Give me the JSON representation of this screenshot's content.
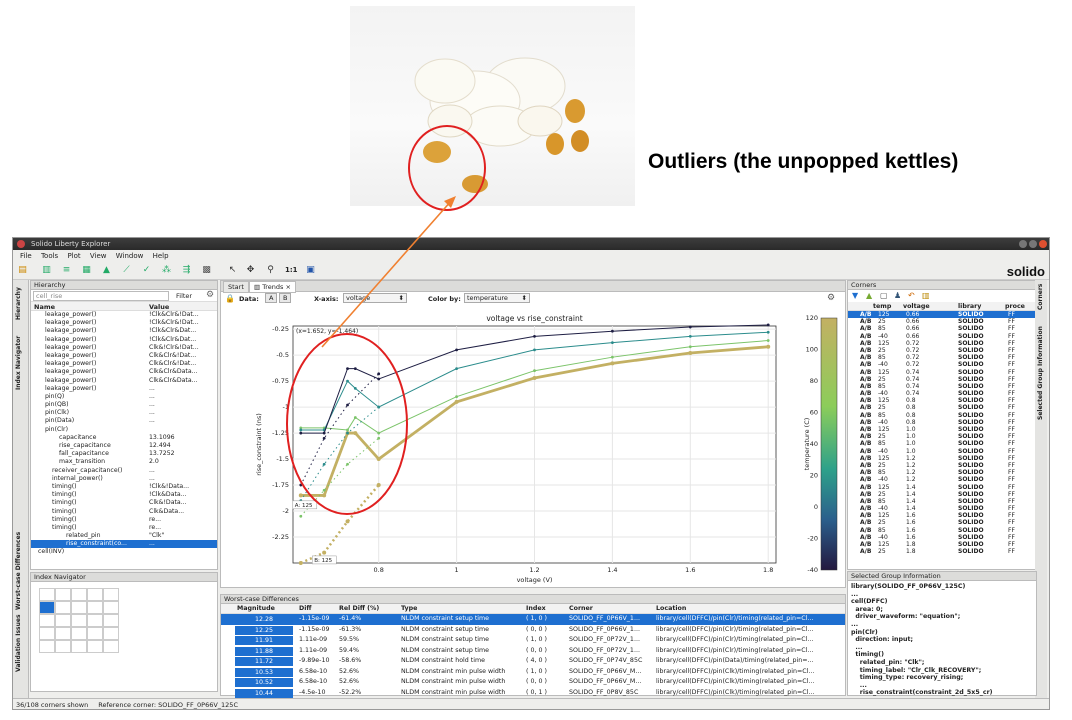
{
  "callout": "Outliers (the unpopped kettles)",
  "app": {
    "title": "Solido Liberty Explorer",
    "logo": "solido"
  },
  "menu": [
    "File",
    "Tools",
    "Plot",
    "View",
    "Window",
    "Help"
  ],
  "toolbar_zoom": "1:1",
  "side_tabs": {
    "left": [
      "Hierarchy",
      "Index Navigator",
      "Worst-case Differences",
      "Validation Issues",
      "Bookmarks"
    ],
    "right": [
      "Corners",
      "Selected Group Information"
    ]
  },
  "hierarchy": {
    "title": "Hierarchy",
    "search": "cell_rise",
    "filter": "Filter",
    "col_name": "Name",
    "col_value": "Value",
    "rows": [
      {
        "n": "leakage_power()",
        "v": "!Clk&Clr&!Dat...",
        "d": 2
      },
      {
        "n": "leakage_power()",
        "v": "!Clk&Clr&!Dat...",
        "d": 2
      },
      {
        "n": "leakage_power()",
        "v": "!Clk&Clr&Dat...",
        "d": 2
      },
      {
        "n": "leakage_power()",
        "v": "!Clk&Clr&Dat...",
        "d": 2
      },
      {
        "n": "leakage_power()",
        "v": "Clk&!Clr&!Dat...",
        "d": 2
      },
      {
        "n": "leakage_power()",
        "v": "Clk&Clr&!Dat...",
        "d": 2
      },
      {
        "n": "leakage_power()",
        "v": "Clk&Clr&!Dat...",
        "d": 2
      },
      {
        "n": "leakage_power()",
        "v": "Clk&Clr&Data...",
        "d": 2
      },
      {
        "n": "leakage_power()",
        "v": "Clk&Clr&Data...",
        "d": 2
      },
      {
        "n": "leakage_power()",
        "v": "...",
        "d": 2
      },
      {
        "n": "pin(Q)",
        "v": "...",
        "d": 2
      },
      {
        "n": "pin(QB)",
        "v": "...",
        "d": 2
      },
      {
        "n": "pin(Clk)",
        "v": "...",
        "d": 2
      },
      {
        "n": "pin(Data)",
        "v": "...",
        "d": 2
      },
      {
        "n": "pin(Clr)",
        "v": "",
        "d": 2
      },
      {
        "n": "capacitance",
        "v": "13.1096",
        "d": 4
      },
      {
        "n": "rise_capacitance",
        "v": "12.494",
        "d": 4
      },
      {
        "n": "fall_capacitance",
        "v": "13.7252",
        "d": 4
      },
      {
        "n": "max_transition",
        "v": "2.0",
        "d": 4
      },
      {
        "n": "receiver_capacitance()",
        "v": "...",
        "d": 3
      },
      {
        "n": "internal_power()",
        "v": "...",
        "d": 3
      },
      {
        "n": "timing()",
        "v": "!Clk&!Data...",
        "d": 3
      },
      {
        "n": "timing()",
        "v": "!Clk&Data...",
        "d": 3
      },
      {
        "n": "timing()",
        "v": "Clk&!Data...",
        "d": 3
      },
      {
        "n": "timing()",
        "v": "Clk&Data...",
        "d": 3
      },
      {
        "n": "timing()",
        "v": "re...",
        "d": 3
      },
      {
        "n": "timing()",
        "v": "re...",
        "d": 3
      },
      {
        "n": "related_pin",
        "v": "\"Clk\"",
        "d": 5
      },
      {
        "n": "rise_constraint(co...",
        "v": "...",
        "d": 5,
        "sel": true
      },
      {
        "n": "cell(INV)",
        "v": "",
        "d": 1
      }
    ]
  },
  "index_nav": {
    "title": "Index Navigator"
  },
  "tabs": [
    "Start",
    "Trends"
  ],
  "trends_bar": {
    "data_label": "Data:",
    "data_a": "A",
    "data_b": "B",
    "xaxis_label": "X-axis:",
    "xaxis_value": "voltage",
    "color_label": "Color by:",
    "color_value": "temperature"
  },
  "chart_data": {
    "type": "line",
    "title": "voltage vs rise_constraint",
    "xlabel": "voltage (V)",
    "ylabel": "rise_constraint (ns)",
    "colorbar_label": "temperature (C)",
    "coord_readout": "(x=1.652, y=-1.464)",
    "xlim": [
      0.58,
      1.82
    ],
    "ylim": [
      -2.5,
      -0.22
    ],
    "xticks": [
      0.8,
      1.0,
      1.2,
      1.4,
      1.6,
      1.8
    ],
    "yticks": [
      -0.25,
      -0.5,
      -0.75,
      -1.0,
      -1.25,
      -1.5,
      -1.75,
      -2.0,
      -2.25
    ],
    "cbar_ticks": [
      120,
      100,
      80,
      60,
      40,
      20,
      0,
      -20,
      -40
    ],
    "point_labels": [
      {
        "text": "A: 125",
        "x": 0.6,
        "y": -1.95
      },
      {
        "text": "B: 125",
        "x": 0.65,
        "y": -2.48
      }
    ],
    "series": [
      {
        "temp": 125,
        "x": [
          0.6,
          0.66,
          0.72,
          0.74,
          0.8,
          1.0,
          1.2,
          1.4,
          1.6,
          1.8
        ],
        "y": [
          -1.85,
          -1.85,
          -1.25,
          -1.25,
          -1.5,
          -0.95,
          -0.72,
          -0.58,
          -0.48,
          -0.42
        ],
        "width": 2.8
      },
      {
        "temp": 85,
        "x": [
          0.6,
          0.66,
          0.72,
          0.74,
          0.8,
          1.0,
          1.2,
          1.4,
          1.6,
          1.8
        ],
        "y": [
          -1.2,
          -1.2,
          -1.22,
          -1.1,
          -1.25,
          -0.9,
          -0.65,
          -0.52,
          -0.42,
          -0.36
        ],
        "width": 1
      },
      {
        "temp": 25,
        "x": [
          0.6,
          0.66,
          0.72,
          0.74,
          0.8,
          1.0,
          1.2,
          1.4,
          1.6,
          1.8
        ],
        "y": [
          -1.22,
          -1.22,
          -0.75,
          -0.82,
          -1.0,
          -0.63,
          -0.45,
          -0.38,
          -0.32,
          -0.28
        ],
        "width": 1
      },
      {
        "temp": -40,
        "x": [
          0.6,
          0.66,
          0.72,
          0.74,
          0.8,
          1.0,
          1.2,
          1.4,
          1.6,
          1.8
        ],
        "y": [
          -1.25,
          -1.25,
          -0.63,
          -0.63,
          -0.73,
          -0.45,
          -0.32,
          -0.27,
          -0.23,
          -0.21
        ],
        "width": 1
      },
      {
        "temp": 125,
        "dotted": true,
        "x": [
          0.6,
          0.66,
          0.72,
          0.8
        ],
        "y": [
          -2.5,
          -2.4,
          -2.1,
          -1.75
        ],
        "width": 2.5
      },
      {
        "temp": 85,
        "dotted": true,
        "x": [
          0.6,
          0.66,
          0.72,
          0.8
        ],
        "y": [
          -2.05,
          -1.8,
          -1.55,
          -1.3
        ],
        "width": 1
      },
      {
        "temp": 25,
        "dotted": true,
        "x": [
          0.6,
          0.66,
          0.72,
          0.8
        ],
        "y": [
          -1.9,
          -1.55,
          -1.25,
          -1.0
        ],
        "width": 1
      },
      {
        "temp": -40,
        "dotted": true,
        "x": [
          0.6,
          0.66,
          0.72,
          0.8
        ],
        "y": [
          -1.75,
          -1.3,
          -0.98,
          -0.68
        ],
        "width": 1
      }
    ]
  },
  "corners": {
    "title": "Corners",
    "cols": [
      "temp",
      "voltage",
      "library",
      "proce"
    ],
    "rows": [
      [
        "A/B",
        "125",
        "0.66",
        "SOLIDO",
        "FF"
      ],
      [
        "A/B",
        "25",
        "0.66",
        "SOLIDO",
        "FF"
      ],
      [
        "A/B",
        "85",
        "0.66",
        "SOLIDO",
        "FF"
      ],
      [
        "A/B",
        "-40",
        "0.66",
        "SOLIDO",
        "FF"
      ],
      [
        "A/B",
        "125",
        "0.72",
        "SOLIDO",
        "FF"
      ],
      [
        "A/B",
        "25",
        "0.72",
        "SOLIDO",
        "FF"
      ],
      [
        "A/B",
        "85",
        "0.72",
        "SOLIDO",
        "FF"
      ],
      [
        "A/B",
        "-40",
        "0.72",
        "SOLIDO",
        "FF"
      ],
      [
        "A/B",
        "125",
        "0.74",
        "SOLIDO",
        "FF"
      ],
      [
        "A/B",
        "25",
        "0.74",
        "SOLIDO",
        "FF"
      ],
      [
        "A/B",
        "85",
        "0.74",
        "SOLIDO",
        "FF"
      ],
      [
        "A/B",
        "-40",
        "0.74",
        "SOLIDO",
        "FF"
      ],
      [
        "A/B",
        "125",
        "0.8",
        "SOLIDO",
        "FF"
      ],
      [
        "A/B",
        "25",
        "0.8",
        "SOLIDO",
        "FF"
      ],
      [
        "A/B",
        "85",
        "0.8",
        "SOLIDO",
        "FF"
      ],
      [
        "A/B",
        "-40",
        "0.8",
        "SOLIDO",
        "FF"
      ],
      [
        "A/B",
        "125",
        "1.0",
        "SOLIDO",
        "FF"
      ],
      [
        "A/B",
        "25",
        "1.0",
        "SOLIDO",
        "FF"
      ],
      [
        "A/B",
        "85",
        "1.0",
        "SOLIDO",
        "FF"
      ],
      [
        "A/B",
        "-40",
        "1.0",
        "SOLIDO",
        "FF"
      ],
      [
        "A/B",
        "125",
        "1.2",
        "SOLIDO",
        "FF"
      ],
      [
        "A/B",
        "25",
        "1.2",
        "SOLIDO",
        "FF"
      ],
      [
        "A/B",
        "85",
        "1.2",
        "SOLIDO",
        "FF"
      ],
      [
        "A/B",
        "-40",
        "1.2",
        "SOLIDO",
        "FF"
      ],
      [
        "A/B",
        "125",
        "1.4",
        "SOLIDO",
        "FF"
      ],
      [
        "A/B",
        "25",
        "1.4",
        "SOLIDO",
        "FF"
      ],
      [
        "A/B",
        "85",
        "1.4",
        "SOLIDO",
        "FF"
      ],
      [
        "A/B",
        "-40",
        "1.4",
        "SOLIDO",
        "FF"
      ],
      [
        "A/B",
        "125",
        "1.6",
        "SOLIDO",
        "FF"
      ],
      [
        "A/B",
        "25",
        "1.6",
        "SOLIDO",
        "FF"
      ],
      [
        "A/B",
        "85",
        "1.6",
        "SOLIDO",
        "FF"
      ],
      [
        "A/B",
        "-40",
        "1.6",
        "SOLIDO",
        "FF"
      ],
      [
        "A/B",
        "125",
        "1.8",
        "SOLIDO",
        "FF"
      ],
      [
        "A/B",
        "25",
        "1.8",
        "SOLIDO",
        "FF"
      ]
    ]
  },
  "sgi": {
    "title": "Selected Group Information",
    "lines": [
      "library(SOLIDO_FF_0P66V_125C)",
      "...",
      "cell(DFFC)",
      "  area: 0;",
      "  driver_waveform: \"equation\";",
      "...",
      "pin(Clr)",
      "  direction: input;",
      "  ...",
      "  timing()",
      "    related_pin: \"Clk\";",
      "    timing_label: \"Clr_Clk_RECOVERY\";",
      "    timing_type: recovery_rising;",
      "    ...",
      "    rise_constraint(constraint_2d_5x5_cr)"
    ]
  },
  "wcd": {
    "title": "Worst-case Differences",
    "cols": [
      "Magnitude",
      "Diff",
      "Rel Diff (%)",
      "Type",
      "Index",
      "Corner",
      "Location"
    ],
    "rows": [
      [
        "12.28",
        "-1.15e-09",
        "-61.4%",
        "NLDM constraint setup time",
        "( 1, 0 )",
        "SOLIDO_FF_0P66V_1...",
        "library/cell(DFFC)/pin(Clr)/timing(related_pin=Cl..."
      ],
      [
        "12.25",
        "-1.15e-09",
        "-61.3%",
        "NLDM constraint setup time",
        "( 0, 0 )",
        "SOLIDO_FF_0P66V_1...",
        "library/cell(DFFC)/pin(Clr)/timing(related_pin=Cl..."
      ],
      [
        "11.91",
        "1.11e-09",
        "59.5%",
        "NLDM constraint setup time",
        "( 1, 0 )",
        "SOLIDO_FF_0P72V_1...",
        "library/cell(DFFC)/pin(Clr)/timing(related_pin=Cl..."
      ],
      [
        "11.88",
        "1.11e-09",
        "59.4%",
        "NLDM constraint setup time",
        "( 0, 0 )",
        "SOLIDO_FF_0P72V_1...",
        "library/cell(DFFC)/pin(Clr)/timing(related_pin=Cl..."
      ],
      [
        "11.72",
        "-9.89e-10",
        "-58.6%",
        "NLDM constraint hold time",
        "( 4, 0 )",
        "SOLIDO_FF_0P74V_85C",
        "library/cell(DFFC)/pin(Data)/timing(related_pin=..."
      ],
      [
        "10.53",
        "6.58e-10",
        "52.6%",
        "NLDM constraint min pulse width",
        "( 1, 0 )",
        "SOLIDO_FF_0P66V_M...",
        "library/cell(DFFC)/pin(Clk)/timing(related_pin=Cl..."
      ],
      [
        "10.52",
        "6.58e-10",
        "52.6%",
        "NLDM constraint min pulse width",
        "( 0, 0 )",
        "SOLIDO_FF_0P66V_M...",
        "library/cell(DFFC)/pin(Clk)/timing(related_pin=Cl..."
      ],
      [
        "10.44",
        "-4.5e-10",
        "-52.2%",
        "NLDM constraint min pulse width",
        "( 0, 1 )",
        "SOLIDO_FF_0P8V_85C",
        "library/cell(DFFC)/pin(Clk)/timing(related_pin=Cl..."
      ]
    ]
  },
  "status": {
    "shown": "36/108 corners shown",
    "ref": "Reference corner: SOLIDO_FF_0P66V_125C"
  }
}
